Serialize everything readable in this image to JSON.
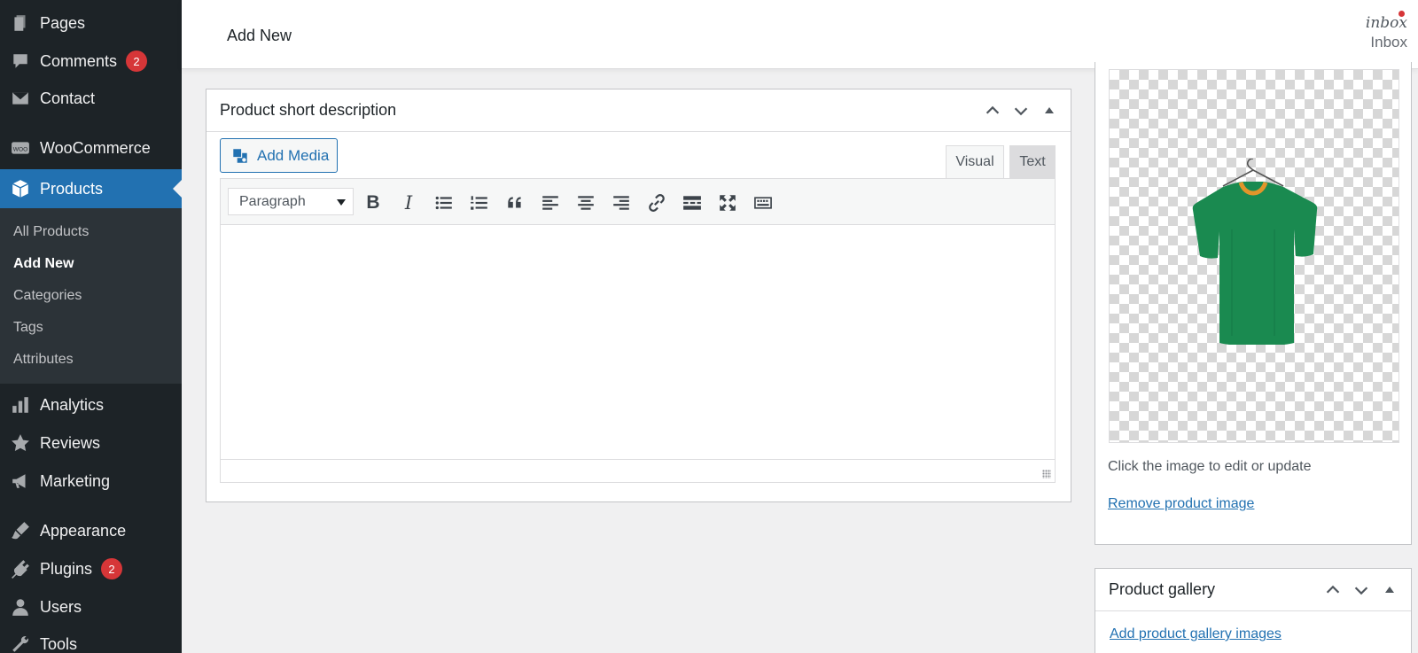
{
  "sidebar": {
    "menu": [
      {
        "label": "Pages",
        "icon": "pages-icon"
      },
      {
        "label": "Comments",
        "icon": "comments-icon",
        "badge": "2"
      },
      {
        "label": "Contact",
        "icon": "mail-icon"
      },
      {
        "label": "WooCommerce",
        "icon": "woocommerce-icon"
      },
      {
        "label": "Products",
        "icon": "products-icon",
        "active": true
      },
      {
        "label": "Analytics",
        "icon": "analytics-icon"
      },
      {
        "label": "Reviews",
        "icon": "star-icon"
      },
      {
        "label": "Marketing",
        "icon": "megaphone-icon"
      },
      {
        "label": "Appearance",
        "icon": "paintbrush-icon"
      },
      {
        "label": "Plugins",
        "icon": "plugin-icon",
        "badge": "2"
      },
      {
        "label": "Users",
        "icon": "users-icon"
      },
      {
        "label": "Tools",
        "icon": "tools-icon"
      }
    ],
    "submenu": [
      {
        "label": "All Products"
      },
      {
        "label": "Add New",
        "current": true
      },
      {
        "label": "Categories"
      },
      {
        "label": "Tags"
      },
      {
        "label": "Attributes"
      }
    ]
  },
  "header": {
    "title": "Add New",
    "inbox_icon_text": "inbox",
    "inbox_label": "Inbox"
  },
  "short_description": {
    "title": "Product short description",
    "add_media_label": "Add Media",
    "tab_visual": "Visual",
    "tab_text": "Text",
    "format_value": "Paragraph",
    "toolbar_buttons": [
      "bold-icon",
      "italic-icon",
      "bullet-list-icon",
      "numbered-list-icon",
      "blockquote-icon",
      "align-left-icon",
      "align-center-icon",
      "align-right-icon",
      "link-icon",
      "read-more-icon",
      "fullscreen-icon",
      "toolbar-toggle-icon"
    ]
  },
  "product_image": {
    "hint": "Click the image to edit or update",
    "remove_label": "Remove product image"
  },
  "product_gallery": {
    "title": "Product gallery",
    "add_label": "Add product gallery images"
  },
  "colors": {
    "sidebar_bg": "#1d2327",
    "accent": "#2271b1",
    "badge": "#d63638",
    "shirt": "#1a8a50",
    "collar": "#e2952a"
  }
}
